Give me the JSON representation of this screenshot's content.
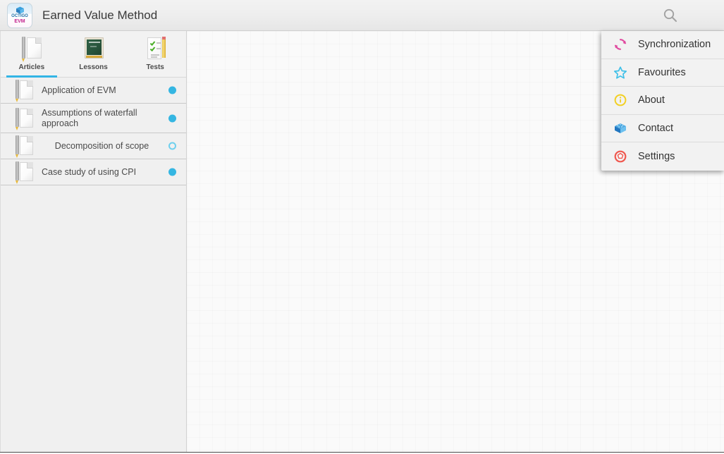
{
  "header": {
    "title": "Earned Value Method",
    "logo": {
      "line1": "OCTIGO",
      "line2": "EVM",
      "icon": "cube-logo-icon"
    },
    "search_icon": "search-icon",
    "menu_icon": "hamburger-menu-icon"
  },
  "sidebar": {
    "tabs": [
      {
        "label": "Articles",
        "icon": "paper-pencil-icon",
        "selected": true
      },
      {
        "label": "Lessons",
        "icon": "chalkboard-icon",
        "selected": false
      },
      {
        "label": "Tests",
        "icon": "checklist-pencil-icon",
        "selected": false
      }
    ],
    "articles": [
      {
        "title": "Application of EVM",
        "status": "filled",
        "centered": false
      },
      {
        "title": "Assumptions of waterfall approach",
        "status": "filled",
        "centered": false
      },
      {
        "title": "Decomposition of scope",
        "status": "hollow",
        "centered": true
      },
      {
        "title": "Case study of using CPI",
        "status": "filled",
        "centered": false
      }
    ]
  },
  "menu": {
    "items": [
      {
        "label": "Synchronization",
        "icon": "sync-refresh-icon",
        "color": "#e0499f"
      },
      {
        "label": "Favourites",
        "icon": "star-icon",
        "color": "#3fc0e8"
      },
      {
        "label": "About",
        "icon": "info-circle-icon",
        "color": "#f2d024"
      },
      {
        "label": "Contact",
        "icon": "contact-cube-icon",
        "color": "#2e8fd6"
      },
      {
        "label": "Settings",
        "icon": "gear-icon",
        "color": "#f0584f"
      }
    ]
  },
  "colors": {
    "accent": "#33b5e5",
    "header_bg": "#eeeeee",
    "sidebar_bg": "#f0f0f0",
    "content_bg": "#fafafa"
  }
}
